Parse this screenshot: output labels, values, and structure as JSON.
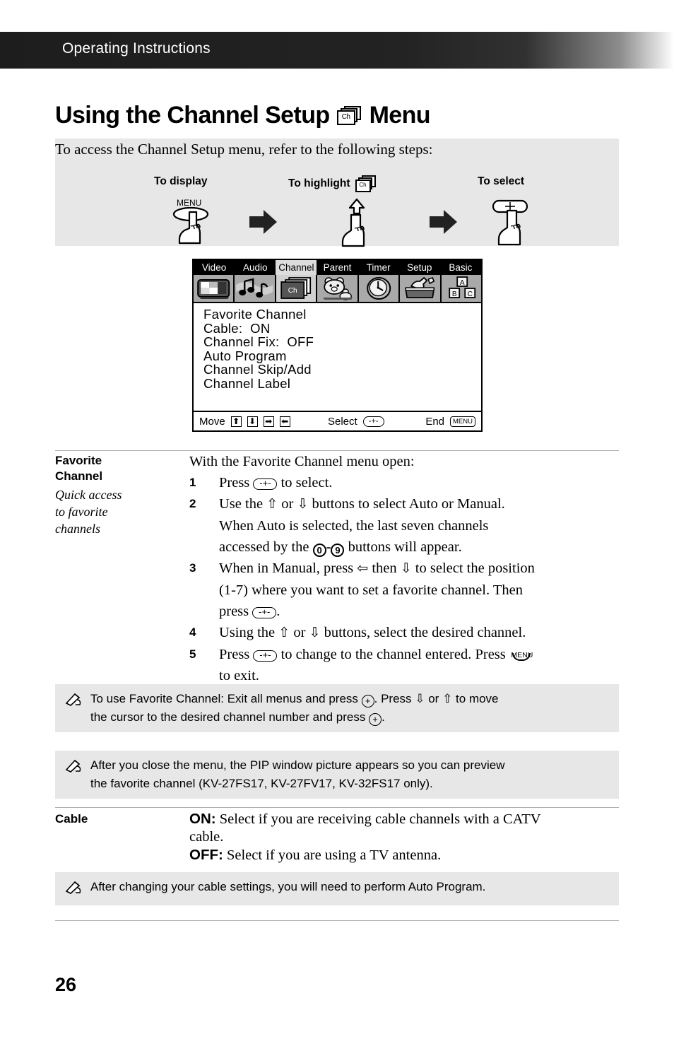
{
  "header": {
    "title": "Operating Instructions"
  },
  "page": {
    "title_before": "Using the Channel Setup",
    "title_after": "Menu",
    "title_icon": "ch-card-icon",
    "number": "26"
  },
  "intro": {
    "text": "To access the Channel Setup menu, refer to the following steps:",
    "steps": [
      {
        "label": "To display",
        "icon": "menu-button-hand-icon",
        "button_label": "MENU"
      },
      {
        "label": "To highlight",
        "icon": "ch-card-icon"
      },
      {
        "label": "To select",
        "icon": "plus-button-hand-icon"
      }
    ]
  },
  "osd": {
    "tabs": [
      {
        "label": "Video",
        "active": false,
        "icon": "picture-icon"
      },
      {
        "label": "Audio",
        "active": false,
        "icon": "music-notes-icon"
      },
      {
        "label": "Channel",
        "active": true,
        "icon": "ch-card-icon"
      },
      {
        "label": "Parent",
        "active": false,
        "icon": "bear-icon"
      },
      {
        "label": "Timer",
        "active": false,
        "icon": "clock-icon"
      },
      {
        "label": "Setup",
        "active": false,
        "icon": "toolbox-icon"
      },
      {
        "label": "Basic",
        "active": false,
        "icon": "abc-blocks-icon"
      }
    ],
    "items": [
      "Favorite Channel",
      "Cable:  ON",
      "Channel Fix:  OFF",
      "Auto Program",
      "Channel Skip/Add",
      "Channel Label"
    ],
    "footer": {
      "move_label": "Move",
      "move_keys": [
        "⬆",
        "⬇",
        "➡",
        "⬅"
      ],
      "select_label": "Select",
      "select_key": "-+-",
      "end_label": "End",
      "end_key": "MENU"
    }
  },
  "favorite_channel": {
    "label_line1": "Favorite",
    "label_line2": "Channel",
    "sub_line1": "Quick access",
    "sub_line2": "to favorite",
    "sub_line3": "channels",
    "intro": "With the Favorite Channel menu open:",
    "steps": [
      {
        "num": "1",
        "lines": [
          "Press ▭ to select."
        ]
      },
      {
        "num": "2",
        "lines": [
          "Use the ⇧ or ⇩ buttons to select Auto or Manual.",
          "When Auto is selected, the last seven channels",
          "accessed by the ⓪-⑨ buttons will appear."
        ]
      },
      {
        "num": "3",
        "lines": [
          "When in Manual, press ⇦ then ⇩ to select the position",
          "(1-7) where you want to set a favorite channel. Then",
          "press ▭."
        ]
      },
      {
        "num": "4",
        "lines": [
          "Using the ⇧ or ⇩ buttons, select the desired channel."
        ]
      },
      {
        "num": "5",
        "lines": [
          "Press ▭ to change to the channel entered. Press MENU",
          "to exit."
        ]
      }
    ]
  },
  "notes": [
    {
      "icon": "note-pencil-icon",
      "line1_a": "To use Favorite Channel: Exit all menus and press ",
      "line1_b": ". Press ⇩ or ⇧ to move",
      "line2_a": "the cursor to the desired channel number and press ",
      "line2_b": "."
    },
    {
      "icon": "note-pencil-icon",
      "line1": "After you close the menu, the PIP window picture appears so you can preview",
      "line2": "the favorite channel (KV-27FS17, KV-27FV17, KV-32FS17 only)."
    }
  ],
  "cable": {
    "label": "Cable",
    "on_key": "ON:",
    "on_text": " Select if you are receiving cable channels with a CATV",
    "on_text2": "cable.",
    "off_key": "OFF:",
    "off_text": " Select if you are using a TV antenna."
  },
  "cable_note": {
    "icon": "note-pencil-icon",
    "text": "After changing your cable settings, you will need to perform Auto Program."
  },
  "colors": {
    "header_bar": "#1d1d1d",
    "panel_gray": "#e7e7e7",
    "osd_tab_bar": "#000000",
    "osd_icon_bar": "#a9a9a9",
    "rule": "#b0b0b0"
  }
}
